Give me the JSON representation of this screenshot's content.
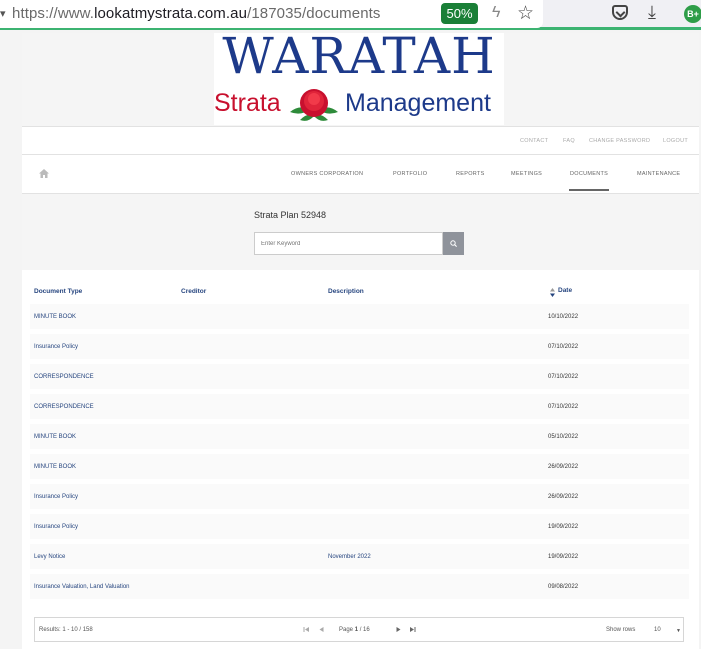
{
  "browser": {
    "url_prefix": "https://www.",
    "url_host": "lookatmystrata.com.au",
    "url_path": "/187035/documents",
    "zoom": "50%",
    "icons": [
      "bolt-icon",
      "star-icon",
      "pocket-icon",
      "download-icon",
      "extension-icon"
    ],
    "extension_badge": "B+"
  },
  "logo": {
    "title": "WARATAH",
    "sub_left": "Strata",
    "sub_right": "Management"
  },
  "utility_nav": [
    "CONTACT",
    "FAQ",
    "CHANGE PASSWORD",
    "LOGOUT"
  ],
  "main_nav": {
    "items": [
      "OWNERS CORPORATION",
      "PORTFOLIO",
      "REPORTS",
      "MEETINGS",
      "DOCUMENTS",
      "MAINTENANCE"
    ],
    "active": "DOCUMENTS"
  },
  "strata_plan": "Strata Plan 52948",
  "search": {
    "placeholder": "Enter Keyword",
    "value": ""
  },
  "table": {
    "columns": [
      "Document Type",
      "Creditor",
      "Description",
      "Date"
    ],
    "rows": [
      {
        "type": "MINUTE BOOK",
        "creditor": "",
        "description": "",
        "date": "10/10/2022"
      },
      {
        "type": "Insurance Policy",
        "creditor": "",
        "description": "",
        "date": "07/10/2022"
      },
      {
        "type": "CORRESPONDENCE",
        "creditor": "",
        "description": "",
        "date": "07/10/2022"
      },
      {
        "type": "CORRESPONDENCE",
        "creditor": "",
        "description": "",
        "date": "07/10/2022"
      },
      {
        "type": "MINUTE BOOK",
        "creditor": "",
        "description": "",
        "date": "05/10/2022"
      },
      {
        "type": "MINUTE BOOK",
        "creditor": "",
        "description": "",
        "date": "26/09/2022"
      },
      {
        "type": "Insurance Policy",
        "creditor": "",
        "description": "",
        "date": "26/09/2022"
      },
      {
        "type": "Insurance Policy",
        "creditor": "",
        "description": "",
        "date": "19/09/2022"
      },
      {
        "type": "Levy Notice",
        "creditor": "",
        "description": "November 2022",
        "date": "19/09/2022"
      },
      {
        "type": "Insurance Valuation, Land Valuation",
        "creditor": "",
        "description": "",
        "date": "09/08/2022"
      }
    ]
  },
  "pagination": {
    "results_label": "Results:",
    "results_range": "1 - 10",
    "results_sep": " / ",
    "results_total": "158",
    "page_label": "Page",
    "page_current": "1",
    "page_sep": " / ",
    "page_total": "16",
    "show_rows_label": "Show rows",
    "rows_value": "10"
  },
  "colors": {
    "link": "#26457f",
    "logo_blue": "#1d3a8a",
    "logo_red": "#c8102e",
    "zoom_badge": "#1a7f37"
  }
}
